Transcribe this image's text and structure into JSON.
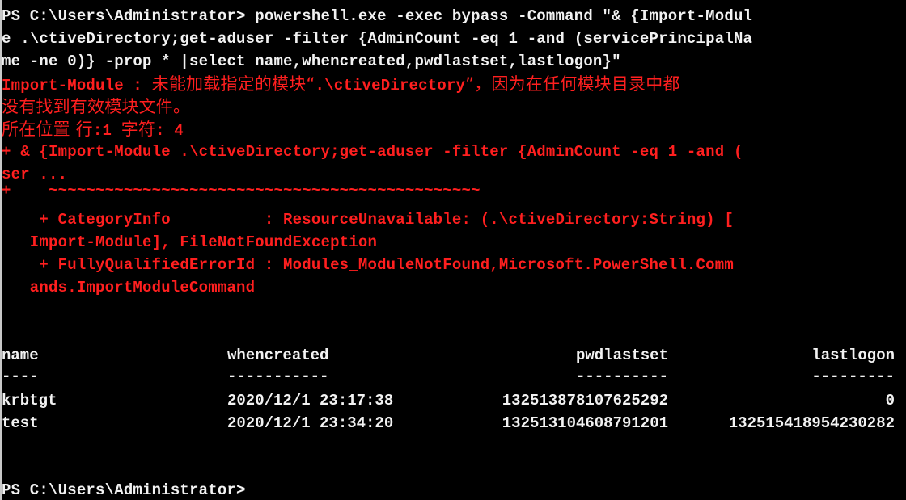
{
  "window": {
    "prompt": "PS C:\\Users\\Administrator>"
  },
  "command": {
    "line1": "PS C:\\Users\\Administrator> powershell.exe -exec bypass -Command \"& {Import-Modul",
    "line2": "e .\\ctiveDirectory;get-aduser -filter {AdminCount -eq 1 -and (servicePrincipalNa",
    "line3": "me -ne 0)} -prop * |select name,whencreated,pwdlastset,lastlogon}\""
  },
  "error": {
    "line1_prefix": "Import-Module : ",
    "line1_cn_a": "未能加载指定的模块“",
    "line1_mid": ".\\ctiveDirectory",
    "line1_cn_b": "”，因为在任何模块目录中都",
    "line2_cn": "没有找到有效模块文件。",
    "line3_cn": "所在位置 行",
    "line3_mid": ":1 ",
    "line3_cn_b": "字符",
    "line3_end": ": 4",
    "line4": "+ & {Import-Module .\\ctiveDirectory;get-aduser -filter {AdminCount -eq 1 -and (",
    "line5": "ser ...",
    "line6": "+    ~~~~~~~~~~~~~~~~~~~~~~~~~~~~~~~~~~~~~~~~~~~~~~",
    "line7": "    + CategoryInfo          : ResourceUnavailable: (.\\ctiveDirectory:String) [",
    "line8": "   Import-Module], FileNotFoundException",
    "line9": "    + FullyQualifiedErrorId : Modules_ModuleNotFound,Microsoft.PowerShell.Comm",
    "line10": "   ands.ImportModuleCommand"
  },
  "table": {
    "headers": [
      "name",
      "whencreated",
      "pwdlastset",
      "lastlogon"
    ],
    "underlines": [
      "----",
      "-----------",
      "----------",
      "---------"
    ],
    "rows": [
      {
        "name": "krbtgt",
        "whencreated": "2020/12/1 23:17:38",
        "pwdlastset": "132513878107625292",
        "lastlogon": "0"
      },
      {
        "name": "test",
        "whencreated": "2020/12/1 23:34:20",
        "pwdlastset": "132513104608791201",
        "lastlogon": "132515418954230282"
      }
    ]
  },
  "colors": {
    "background": "#000000",
    "text": "#f2f2f2",
    "error": "#ff1f1f",
    "left_edge": "#c8c8c8"
  }
}
